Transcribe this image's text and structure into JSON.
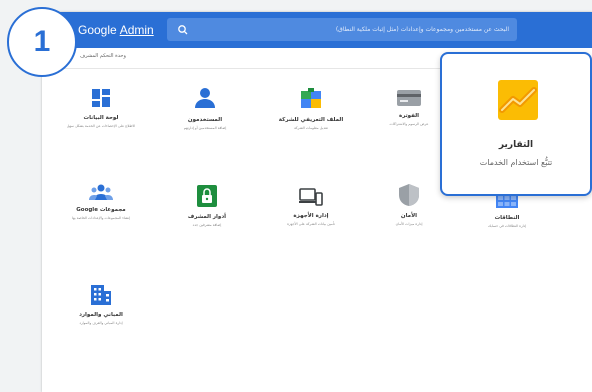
{
  "step_badge": "1",
  "header": {
    "brand_google": "Google",
    "brand_admin": "Admin",
    "search_placeholder": "البحث عن مستخدمين ومجموعات وإعدادات (مثل إثبات ملكية النطاق)",
    "breadcrumb": "وحدة التحكم المشرف"
  },
  "tiles": [
    {
      "title": "لوحة البيانات",
      "subtitle": "الاطلاع على الإحصاءات عن الخدمة بشكل سهل"
    },
    {
      "title": "المستخدمون",
      "subtitle": "إضافة المستخدمين أو إدارتهم"
    },
    {
      "title": "الملف التعريفي للشركة",
      "subtitle": "تعديل معلومات الشركة"
    },
    {
      "title": "الفوترة",
      "subtitle": "عرض الرسوم والاشتراكات"
    },
    {
      "title": "مجموعات Google",
      "subtitle": "إنشاء المجموعات والإعدادات الخاصة بها"
    },
    {
      "title": "أدوار المشرف",
      "subtitle": "إضافة مشرفين جدد"
    },
    {
      "title": "إدارة الأجهزة",
      "subtitle": "تأمين بيانات الشركة على الأجهزة"
    },
    {
      "title": "الأمان",
      "subtitle": "إدارة ميزات الأمان"
    },
    {
      "title": "النطاقات",
      "subtitle": "إدارة النطاقات في حسابك"
    },
    {
      "title": "المباني والموارد",
      "subtitle": "إدارة المباني والغرف والموارد"
    }
  ],
  "popup": {
    "title": "التقارير",
    "subtitle": "تتبُّع استخدام الخدمات"
  },
  "colors": {
    "brand_blue": "#2a6fd5",
    "search_blue": "#4f8ae0",
    "green": "#1e8e3e",
    "report_yellow": "#fbbc04",
    "report_orange": "#f29900"
  }
}
